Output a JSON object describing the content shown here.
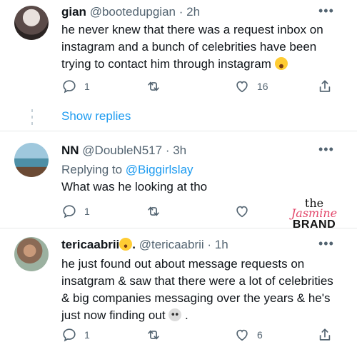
{
  "tweets": [
    {
      "name": "gian",
      "handle": "@bootedupgian",
      "time": "· 2h",
      "text": "he never knew that there was a request inbox on instagram and a bunch of celebrities have been trying to contact him through instagram",
      "emoji": "crying-laughing-emoji",
      "replies": "1",
      "retweets": "",
      "likes": "16"
    },
    {
      "name": "NN",
      "handle": "@DoubleN517",
      "time": "· 3h",
      "replying_prefix": "Replying to",
      "replying_to": "@Biggirlslay",
      "text": "What was he looking at tho",
      "replies": "1",
      "retweets": "",
      "likes": ""
    },
    {
      "name": "tericaabrii",
      "name_suffix": ".",
      "handle": "@tericaabrii",
      "time": "· 1h",
      "text": "he just found out about message requests on insatgram & saw that there were a lot of celebrities & big companies messaging over the years & he's just now finding out",
      "text_end": ".",
      "emoji": "skull-emoji",
      "replies": "1",
      "retweets": "",
      "likes": "6"
    }
  ],
  "show_replies": "Show replies",
  "more_glyph": "•••",
  "watermark": {
    "the": "the",
    "jasmine": "Jasmine",
    "brand": "BRAND"
  },
  "colors": {
    "accent": "#1d9bf0",
    "muted": "#536471",
    "divider": "#e7e9ea",
    "brand_pink": "#e3476b"
  }
}
